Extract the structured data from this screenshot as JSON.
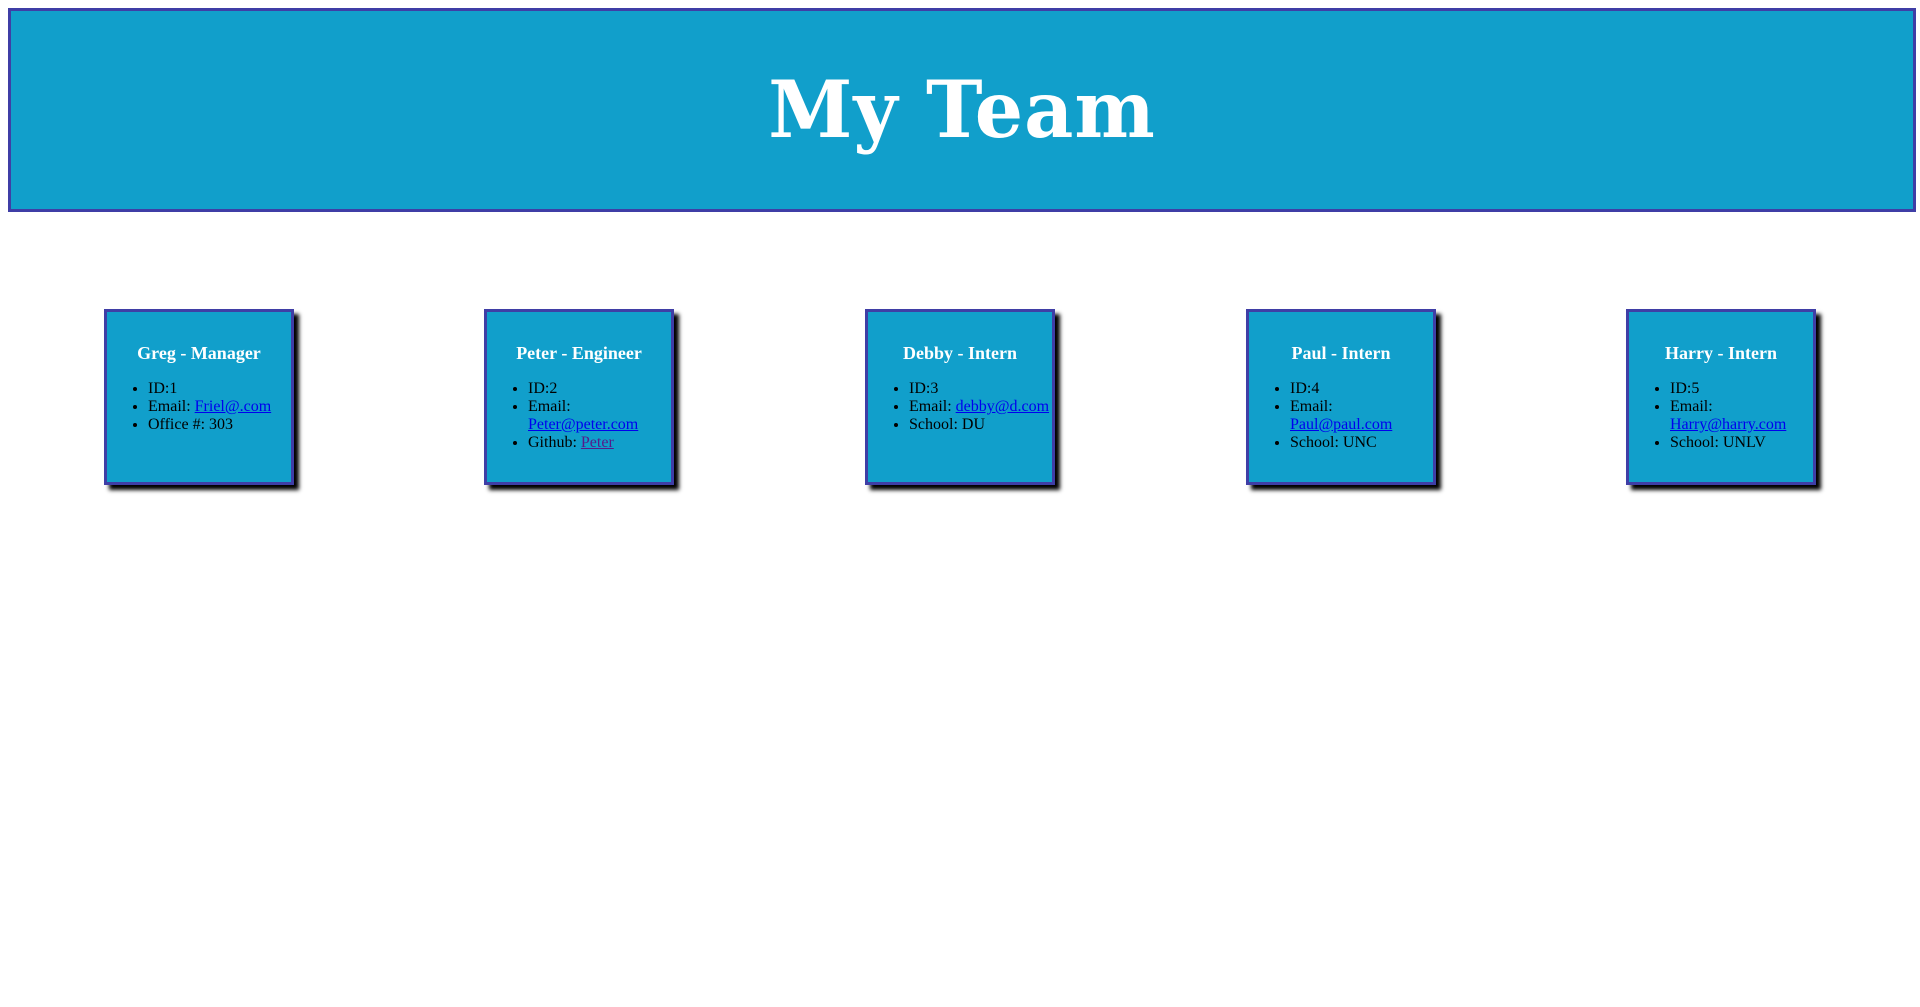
{
  "header": {
    "title": "My Team"
  },
  "cards": [
    {
      "title": "Greg - Manager",
      "id_text": "ID:1",
      "email_label": "Email: ",
      "email_link": "Friel@.com",
      "extra_label": "Office #: 303",
      "extra_link": ""
    },
    {
      "title": "Peter - Engineer",
      "id_text": "ID:2",
      "email_label": "Email: ",
      "email_link": "Peter@peter.com",
      "extra_label": "Github: ",
      "extra_link": "Peter"
    },
    {
      "title": "Debby - Intern",
      "id_text": "ID:3",
      "email_label": "Email: ",
      "email_link": "debby@d.com",
      "extra_label": "School: DU",
      "extra_link": ""
    },
    {
      "title": "Paul - Intern",
      "id_text": "ID:4",
      "email_label": "Email: ",
      "email_link": "Paul@paul.com",
      "extra_label": "School: UNC",
      "extra_link": ""
    },
    {
      "title": "Harry - Intern",
      "id_text": "ID:5",
      "email_label": "Email: ",
      "email_link": "Harry@harry.com",
      "extra_label": "School: UNLV",
      "extra_link": ""
    }
  ],
  "colors": {
    "header_bg": "#119fcb",
    "border": "#3f3ea6",
    "card_bg": "#119fcb",
    "link": "#0000ee",
    "visited_link": "#551a8b"
  }
}
